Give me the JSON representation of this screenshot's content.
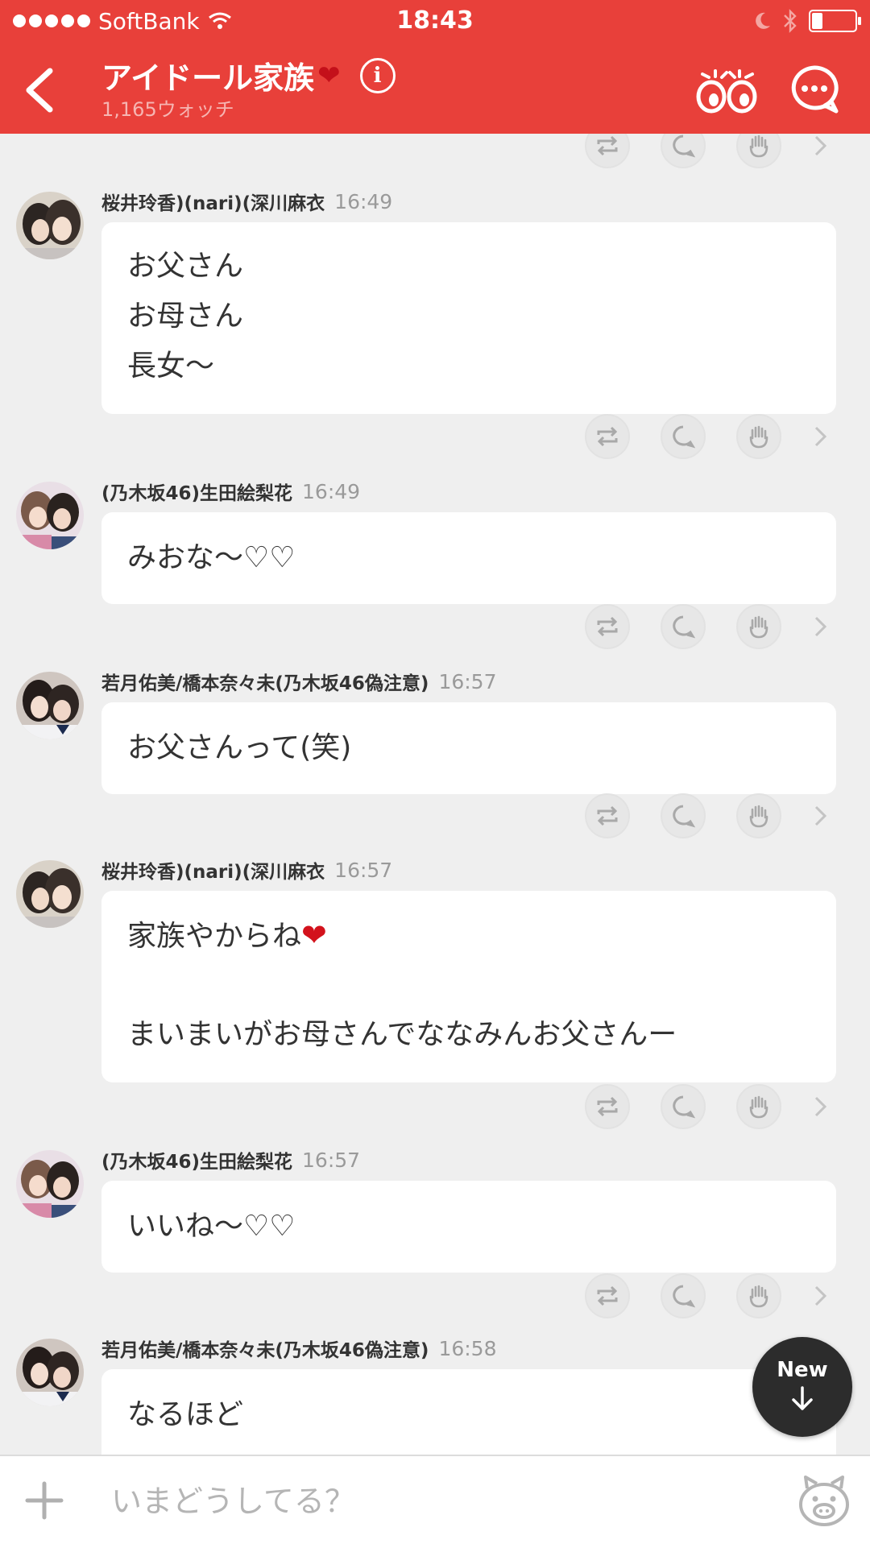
{
  "status_bar": {
    "carrier": "SoftBank",
    "time": "18:43",
    "battery_level": 0.25
  },
  "header": {
    "title": "アイドール家族",
    "title_emoji": "❤",
    "subtitle": "1,165ウォッチ",
    "info_label": "i",
    "accent_color": "#e8403a"
  },
  "posts": [
    {
      "author": "桜井玲香)(nari)(深川麻衣",
      "time": "16:49",
      "lines": [
        "お父さん",
        "お母さん",
        "長女〜"
      ]
    },
    {
      "author": "(乃木坂46)生田絵梨花",
      "time": "16:49",
      "lines": [
        "みおな〜♡♡"
      ]
    },
    {
      "author": "若月佑美/橋本奈々未(乃木坂46偽注意)",
      "time": "16:57",
      "lines": [
        "お父さんって(笑)"
      ]
    },
    {
      "author": "桜井玲香)(nari)(深川麻衣",
      "time": "16:57",
      "lines": [
        "家族やからね",
        "",
        "まいまいがお母さんでななみんお父さんー"
      ],
      "emoji_line0": "❤"
    },
    {
      "author": "(乃木坂46)生田絵梨花",
      "time": "16:57",
      "lines": [
        "いいね〜♡♡"
      ]
    },
    {
      "author": "若月佑美/橋本奈々未(乃木坂46偽注意)",
      "time": "16:58",
      "lines": [
        "なるほど"
      ]
    }
  ],
  "action_icons": [
    "retweet-icon",
    "reply-icon",
    "clap-icon",
    "chevron-right-icon"
  ],
  "new_button": {
    "label": "New"
  },
  "composer": {
    "placeholder": "いまどうしてる？"
  }
}
